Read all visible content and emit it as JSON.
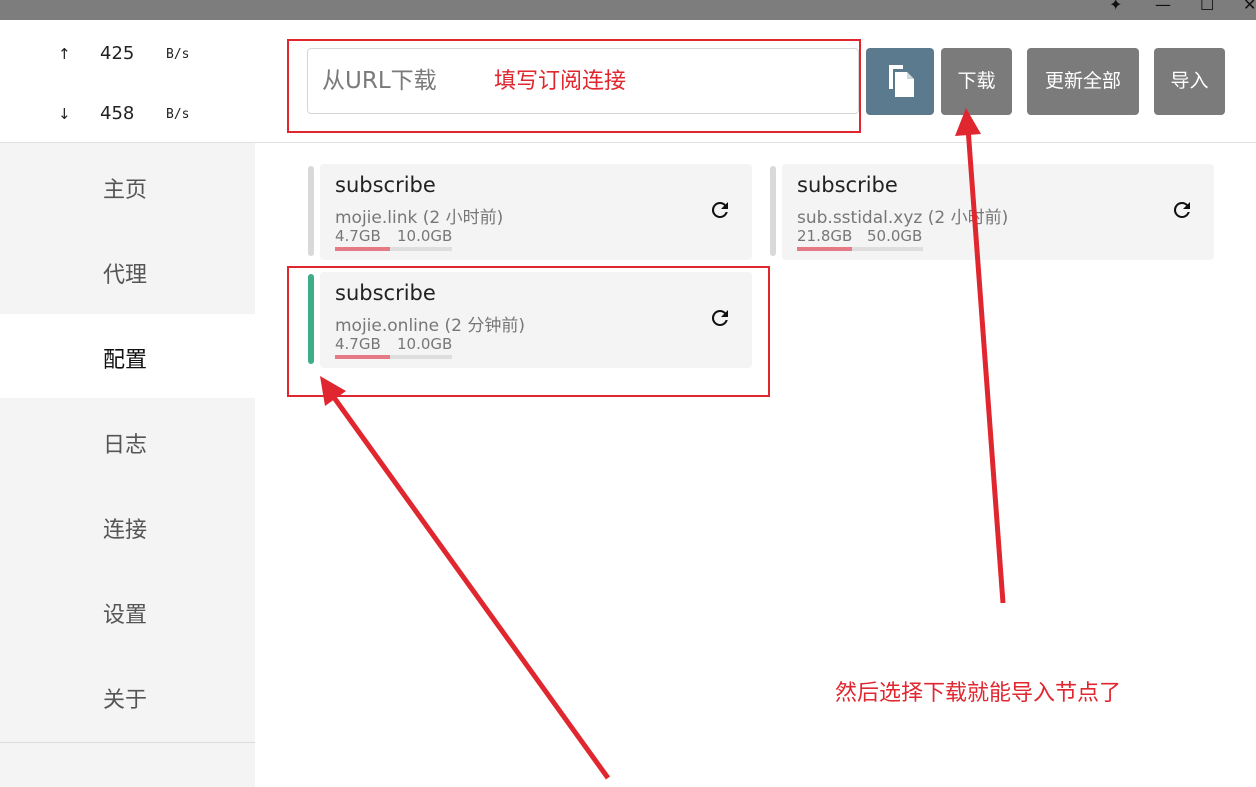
{
  "window": {
    "controls": [
      "pin",
      "minimize",
      "maximize",
      "close"
    ]
  },
  "traffic": {
    "up": {
      "arrow": "↑",
      "value": "425",
      "unit": "B/s"
    },
    "down": {
      "arrow": "↓",
      "value": "458",
      "unit": "B/s"
    }
  },
  "sidebar": {
    "items": [
      {
        "label": "主页"
      },
      {
        "label": "代理"
      },
      {
        "label": "配置"
      },
      {
        "label": "日志"
      },
      {
        "label": "连接"
      },
      {
        "label": "设置"
      },
      {
        "label": "关于"
      }
    ],
    "active": "配置"
  },
  "toolbar": {
    "url_placeholder": "从URL下载",
    "paste_icon": "paste-icon",
    "download_label": "下载",
    "update_all_label": "更新全部",
    "import_label": "导入"
  },
  "profiles": [
    {
      "name": "subscribe",
      "host": "mojie.link",
      "updated": "(2 小时前)",
      "used": "4.7GB",
      "total": "10.0GB",
      "usage_fraction": 0.47,
      "active": false
    },
    {
      "name": "subscribe",
      "host": "sub.sstidal.xyz",
      "updated": "(2 小时前)",
      "used": "21.8GB",
      "total": "50.0GB",
      "usage_fraction": 0.44,
      "active": false
    },
    {
      "name": "subscribe",
      "host": "mojie.online",
      "updated": "(2 分钟前)",
      "used": "4.7GB",
      "total": "10.0GB",
      "usage_fraction": 0.47,
      "active": true
    }
  ],
  "annotations": {
    "url_hint": "填写订阅连接",
    "download_hint": "然后选择下载就能导入节点了",
    "color": "#e0262f"
  },
  "colors": {
    "active_bar": "#3dae85",
    "usage_fill": "#e57a86",
    "paste_button": "#5c7a8d",
    "button": "#7b7b7b"
  }
}
